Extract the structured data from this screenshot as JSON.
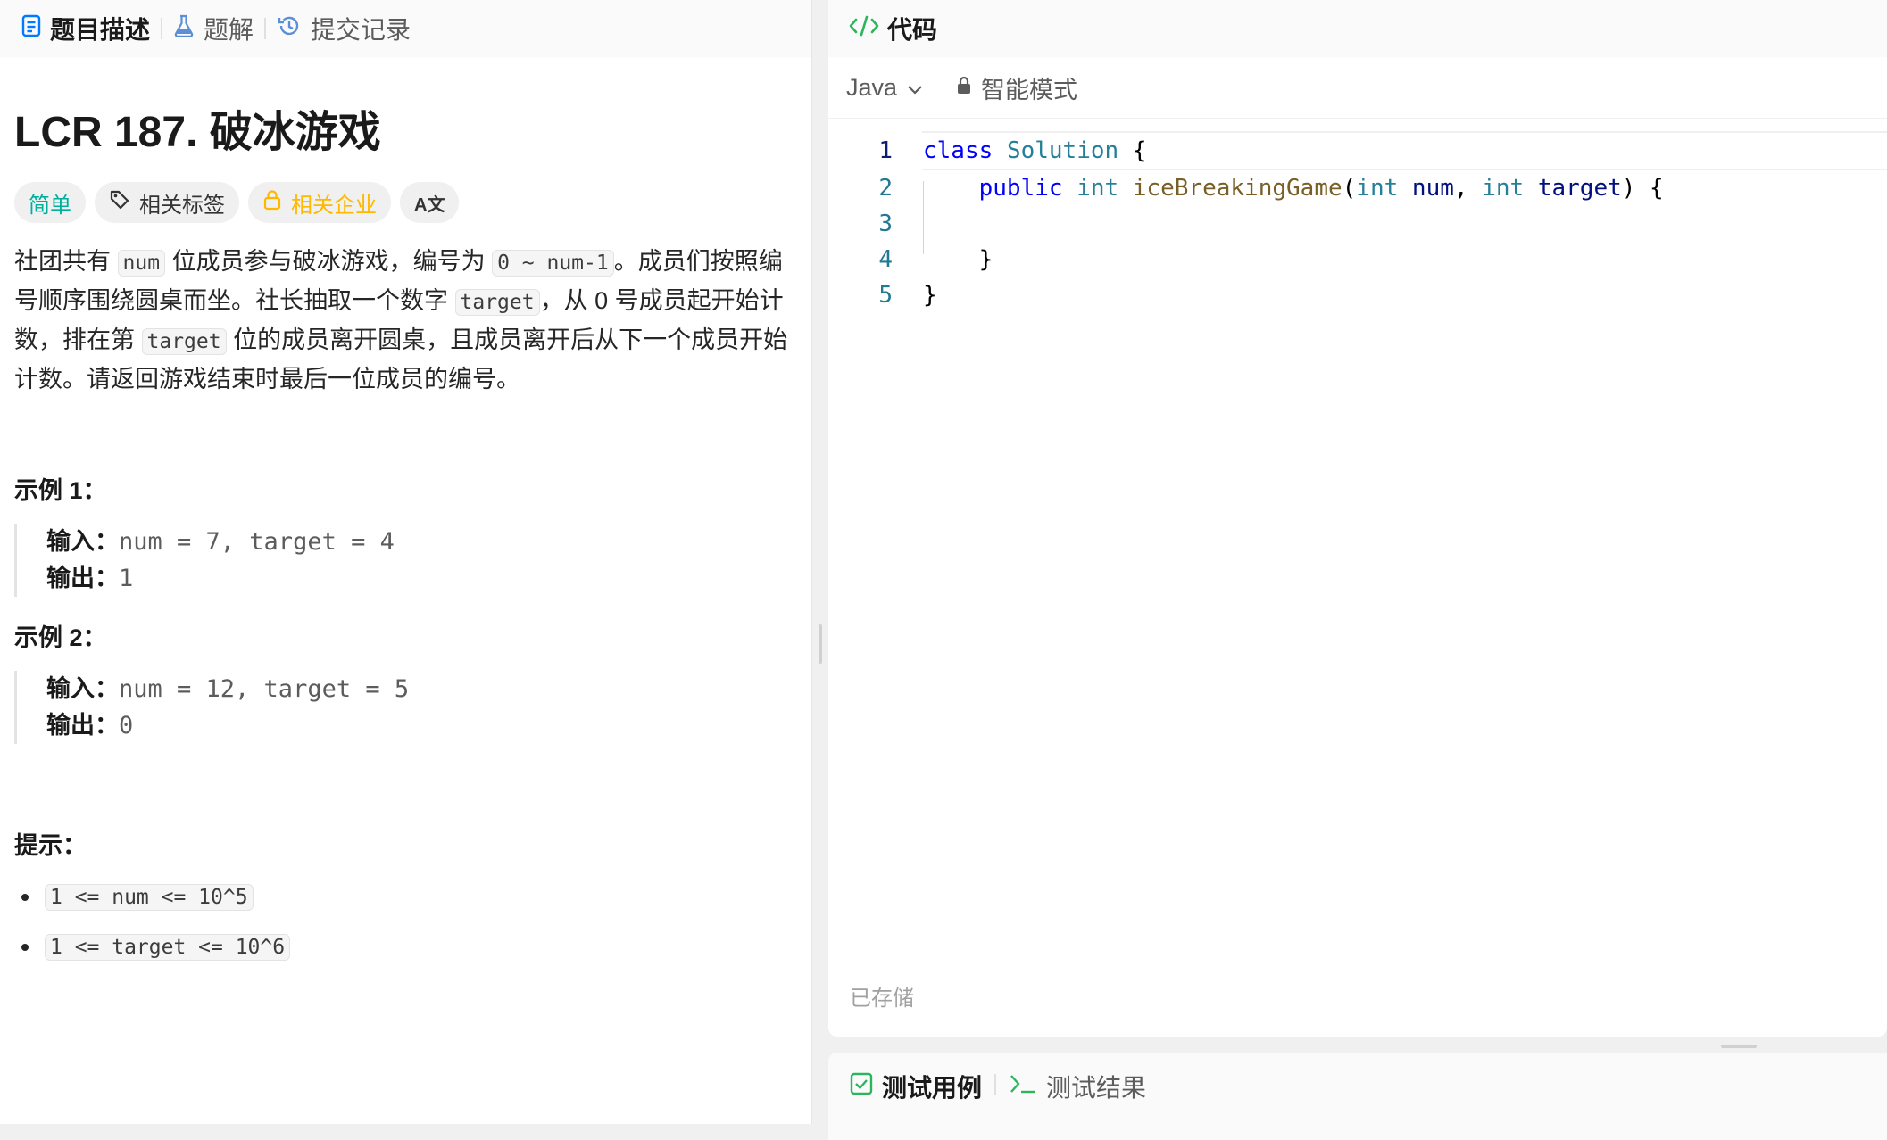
{
  "left_tabs": [
    {
      "label": "题目描述",
      "icon": "document-icon",
      "active": true
    },
    {
      "label": "题解",
      "icon": "flask-icon",
      "active": false
    },
    {
      "label": "提交记录",
      "icon": "history-icon",
      "active": false
    }
  ],
  "problem": {
    "title": "LCR 187. 破冰游戏",
    "tags": {
      "difficulty": "简单",
      "related_tags": "相关标签",
      "related_companies": "相关企业",
      "translate_glyph": "A文"
    },
    "description": {
      "p1": "社团共有 ",
      "c1": "num",
      "p2": " 位成员参与破冰游戏，编号为 ",
      "c2": "0 ~ num-1",
      "p3": "。成员们按照编号顺序围绕圆桌而坐。社长抽取一个数字 ",
      "c3": "target",
      "p4": "，从 0 号成员起开始计数，排在第 ",
      "c4": "target",
      "p5": " 位的成员离开圆桌，且成员离开后从下一个成员开始计数。请返回游戏结束时最后一位成员的编号。"
    },
    "examples": [
      {
        "title": "示例 1：",
        "input_label": "输入：",
        "input": "num = 7, target = 4",
        "output_label": "输出：",
        "output": "1"
      },
      {
        "title": "示例 2：",
        "input_label": "输入：",
        "input": "num = 12, target = 5",
        "output_label": "输出：",
        "output": "0"
      }
    ],
    "hints_title": "提示：",
    "hints": [
      "1 <= num <= 10^5",
      "1 <= target <= 10^6"
    ]
  },
  "code_panel": {
    "title": "代码",
    "language": "Java",
    "mode": "智能模式",
    "saved_status": "已存储",
    "line_numbers": [
      "1",
      "2",
      "3",
      "4",
      "5"
    ],
    "code": {
      "l1_kw": "class",
      "l1_cls": "Solution",
      "l1_rest": " {",
      "l2_kw": "public",
      "l2_type": "int",
      "l2_fn": "iceBreakingGame",
      "l2_p1_type": "int",
      "l2_p1": "num",
      "l2_p2_type": "int",
      "l2_p2": "target",
      "l4": "    }",
      "l5": "}"
    }
  },
  "bottom_tabs": [
    {
      "label": "测试用例",
      "icon": "checkbox-icon",
      "active": true
    },
    {
      "label": "测试结果",
      "icon": "terminal-icon",
      "active": false
    }
  ],
  "colors": {
    "easy": "#00af9b",
    "company": "#ffb800",
    "code_icon": "#2db55d",
    "doc_icon": "#007aff"
  }
}
